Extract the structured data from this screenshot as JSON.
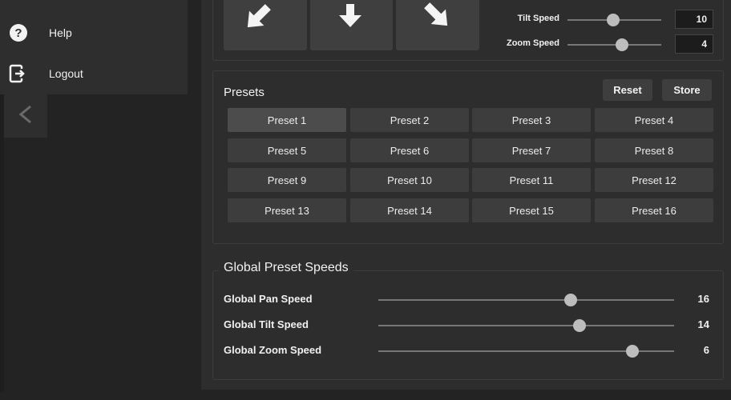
{
  "nav": {
    "items": [
      {
        "label": "Help",
        "icon": "help-icon"
      },
      {
        "label": "Logout",
        "icon": "logout-icon"
      }
    ],
    "collapse_glyph": "<"
  },
  "dpad": {
    "buttons": [
      {
        "icon": "arrow-down-left-icon"
      },
      {
        "icon": "arrow-down-icon"
      },
      {
        "icon": "arrow-down-right-icon"
      }
    ]
  },
  "speeds": {
    "tilt": {
      "label": "Tilt Speed",
      "value": "10",
      "fraction": 0.49
    },
    "zoom": {
      "label": "Zoom Speed",
      "value": "4",
      "fraction": 0.58
    }
  },
  "presets": {
    "title": "Presets",
    "reset_label": "Reset",
    "store_label": "Store",
    "items": [
      "Preset 1",
      "Preset 2",
      "Preset 3",
      "Preset 4",
      "Preset 5",
      "Preset 6",
      "Preset 7",
      "Preset 8",
      "Preset 9",
      "Preset 10",
      "Preset 11",
      "Preset 12",
      "Preset 13",
      "Preset 14",
      "Preset 15",
      "Preset 16"
    ],
    "selected": "Preset 1"
  },
  "global_speeds": {
    "title": "Global Preset Speeds",
    "rows": [
      {
        "label": "Global Pan Speed",
        "value": "16",
        "fraction": 0.65
      },
      {
        "label": "Global Tilt Speed",
        "value": "14",
        "fraction": 0.68
      },
      {
        "label": "Global Zoom Speed",
        "value": "6",
        "fraction": 0.86
      }
    ]
  },
  "colors": {
    "background": "#232323",
    "panel": "#2d2d2d",
    "button": "#3d3d3d",
    "knob": "#bdbdbd"
  }
}
